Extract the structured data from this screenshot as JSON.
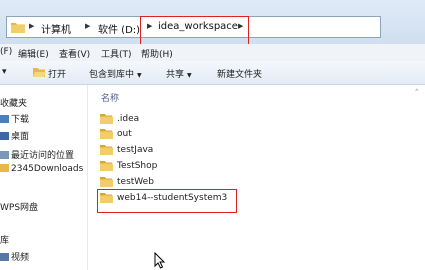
{
  "address_bar": {
    "crumbs": [
      "计算机",
      "软件 (D:)",
      "idea_workspace"
    ]
  },
  "menu": {
    "items": [
      "(F)",
      "编辑(E)",
      "查看(V)",
      "工具(T)",
      "帮助(H)"
    ]
  },
  "toolbar": {
    "organize_label": "▾",
    "open_label": "打开",
    "include_label": "包含到库中",
    "share_label": "共享",
    "new_folder_label": "新建文件夹"
  },
  "nav": {
    "favorites_label": "收藏夹",
    "favorites": [
      "下载",
      "桌面",
      "最近访问的位置",
      "2345Downloads"
    ],
    "wps_label": "WPS网盘",
    "libraries_label": "库",
    "libraries": [
      "视频"
    ]
  },
  "file_list": {
    "column_name": "名称",
    "files": [
      ".idea",
      "out",
      "testJava",
      "TestShop",
      "testWeb",
      "web14--studentSystem3"
    ],
    "highlighted": "web14--studentSystem3"
  },
  "colors": {
    "highlight_border": "#e02020",
    "folder": "#e8b84a",
    "chrome": "#dfeaf6"
  },
  "icons": [
    "folder-icon",
    "open-icon",
    "cursor-icon",
    "chevron-right-icon"
  ]
}
